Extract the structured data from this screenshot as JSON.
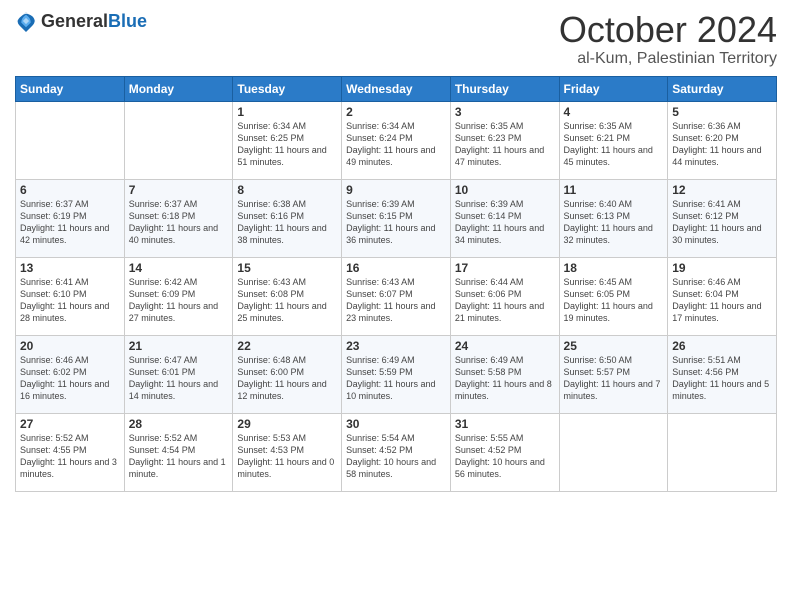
{
  "logo": {
    "general": "General",
    "blue": "Blue"
  },
  "title": "October 2024",
  "subtitle": "al-Kum, Palestinian Territory",
  "days_of_week": [
    "Sunday",
    "Monday",
    "Tuesday",
    "Wednesday",
    "Thursday",
    "Friday",
    "Saturday"
  ],
  "weeks": [
    [
      {
        "day": "",
        "sunrise": "",
        "sunset": "",
        "daylight": ""
      },
      {
        "day": "",
        "sunrise": "",
        "sunset": "",
        "daylight": ""
      },
      {
        "day": "1",
        "sunrise": "Sunrise: 6:34 AM",
        "sunset": "Sunset: 6:25 PM",
        "daylight": "Daylight: 11 hours and 51 minutes."
      },
      {
        "day": "2",
        "sunrise": "Sunrise: 6:34 AM",
        "sunset": "Sunset: 6:24 PM",
        "daylight": "Daylight: 11 hours and 49 minutes."
      },
      {
        "day": "3",
        "sunrise": "Sunrise: 6:35 AM",
        "sunset": "Sunset: 6:23 PM",
        "daylight": "Daylight: 11 hours and 47 minutes."
      },
      {
        "day": "4",
        "sunrise": "Sunrise: 6:35 AM",
        "sunset": "Sunset: 6:21 PM",
        "daylight": "Daylight: 11 hours and 45 minutes."
      },
      {
        "day": "5",
        "sunrise": "Sunrise: 6:36 AM",
        "sunset": "Sunset: 6:20 PM",
        "daylight": "Daylight: 11 hours and 44 minutes."
      }
    ],
    [
      {
        "day": "6",
        "sunrise": "Sunrise: 6:37 AM",
        "sunset": "Sunset: 6:19 PM",
        "daylight": "Daylight: 11 hours and 42 minutes."
      },
      {
        "day": "7",
        "sunrise": "Sunrise: 6:37 AM",
        "sunset": "Sunset: 6:18 PM",
        "daylight": "Daylight: 11 hours and 40 minutes."
      },
      {
        "day": "8",
        "sunrise": "Sunrise: 6:38 AM",
        "sunset": "Sunset: 6:16 PM",
        "daylight": "Daylight: 11 hours and 38 minutes."
      },
      {
        "day": "9",
        "sunrise": "Sunrise: 6:39 AM",
        "sunset": "Sunset: 6:15 PM",
        "daylight": "Daylight: 11 hours and 36 minutes."
      },
      {
        "day": "10",
        "sunrise": "Sunrise: 6:39 AM",
        "sunset": "Sunset: 6:14 PM",
        "daylight": "Daylight: 11 hours and 34 minutes."
      },
      {
        "day": "11",
        "sunrise": "Sunrise: 6:40 AM",
        "sunset": "Sunset: 6:13 PM",
        "daylight": "Daylight: 11 hours and 32 minutes."
      },
      {
        "day": "12",
        "sunrise": "Sunrise: 6:41 AM",
        "sunset": "Sunset: 6:12 PM",
        "daylight": "Daylight: 11 hours and 30 minutes."
      }
    ],
    [
      {
        "day": "13",
        "sunrise": "Sunrise: 6:41 AM",
        "sunset": "Sunset: 6:10 PM",
        "daylight": "Daylight: 11 hours and 28 minutes."
      },
      {
        "day": "14",
        "sunrise": "Sunrise: 6:42 AM",
        "sunset": "Sunset: 6:09 PM",
        "daylight": "Daylight: 11 hours and 27 minutes."
      },
      {
        "day": "15",
        "sunrise": "Sunrise: 6:43 AM",
        "sunset": "Sunset: 6:08 PM",
        "daylight": "Daylight: 11 hours and 25 minutes."
      },
      {
        "day": "16",
        "sunrise": "Sunrise: 6:43 AM",
        "sunset": "Sunset: 6:07 PM",
        "daylight": "Daylight: 11 hours and 23 minutes."
      },
      {
        "day": "17",
        "sunrise": "Sunrise: 6:44 AM",
        "sunset": "Sunset: 6:06 PM",
        "daylight": "Daylight: 11 hours and 21 minutes."
      },
      {
        "day": "18",
        "sunrise": "Sunrise: 6:45 AM",
        "sunset": "Sunset: 6:05 PM",
        "daylight": "Daylight: 11 hours and 19 minutes."
      },
      {
        "day": "19",
        "sunrise": "Sunrise: 6:46 AM",
        "sunset": "Sunset: 6:04 PM",
        "daylight": "Daylight: 11 hours and 17 minutes."
      }
    ],
    [
      {
        "day": "20",
        "sunrise": "Sunrise: 6:46 AM",
        "sunset": "Sunset: 6:02 PM",
        "daylight": "Daylight: 11 hours and 16 minutes."
      },
      {
        "day": "21",
        "sunrise": "Sunrise: 6:47 AM",
        "sunset": "Sunset: 6:01 PM",
        "daylight": "Daylight: 11 hours and 14 minutes."
      },
      {
        "day": "22",
        "sunrise": "Sunrise: 6:48 AM",
        "sunset": "Sunset: 6:00 PM",
        "daylight": "Daylight: 11 hours and 12 minutes."
      },
      {
        "day": "23",
        "sunrise": "Sunrise: 6:49 AM",
        "sunset": "Sunset: 5:59 PM",
        "daylight": "Daylight: 11 hours and 10 minutes."
      },
      {
        "day": "24",
        "sunrise": "Sunrise: 6:49 AM",
        "sunset": "Sunset: 5:58 PM",
        "daylight": "Daylight: 11 hours and 8 minutes."
      },
      {
        "day": "25",
        "sunrise": "Sunrise: 6:50 AM",
        "sunset": "Sunset: 5:57 PM",
        "daylight": "Daylight: 11 hours and 7 minutes."
      },
      {
        "day": "26",
        "sunrise": "Sunrise: 5:51 AM",
        "sunset": "Sunset: 4:56 PM",
        "daylight": "Daylight: 11 hours and 5 minutes."
      }
    ],
    [
      {
        "day": "27",
        "sunrise": "Sunrise: 5:52 AM",
        "sunset": "Sunset: 4:55 PM",
        "daylight": "Daylight: 11 hours and 3 minutes."
      },
      {
        "day": "28",
        "sunrise": "Sunrise: 5:52 AM",
        "sunset": "Sunset: 4:54 PM",
        "daylight": "Daylight: 11 hours and 1 minute."
      },
      {
        "day": "29",
        "sunrise": "Sunrise: 5:53 AM",
        "sunset": "Sunset: 4:53 PM",
        "daylight": "Daylight: 11 hours and 0 minutes."
      },
      {
        "day": "30",
        "sunrise": "Sunrise: 5:54 AM",
        "sunset": "Sunset: 4:52 PM",
        "daylight": "Daylight: 10 hours and 58 minutes."
      },
      {
        "day": "31",
        "sunrise": "Sunrise: 5:55 AM",
        "sunset": "Sunset: 4:52 PM",
        "daylight": "Daylight: 10 hours and 56 minutes."
      },
      {
        "day": "",
        "sunrise": "",
        "sunset": "",
        "daylight": ""
      },
      {
        "day": "",
        "sunrise": "",
        "sunset": "",
        "daylight": ""
      }
    ]
  ]
}
